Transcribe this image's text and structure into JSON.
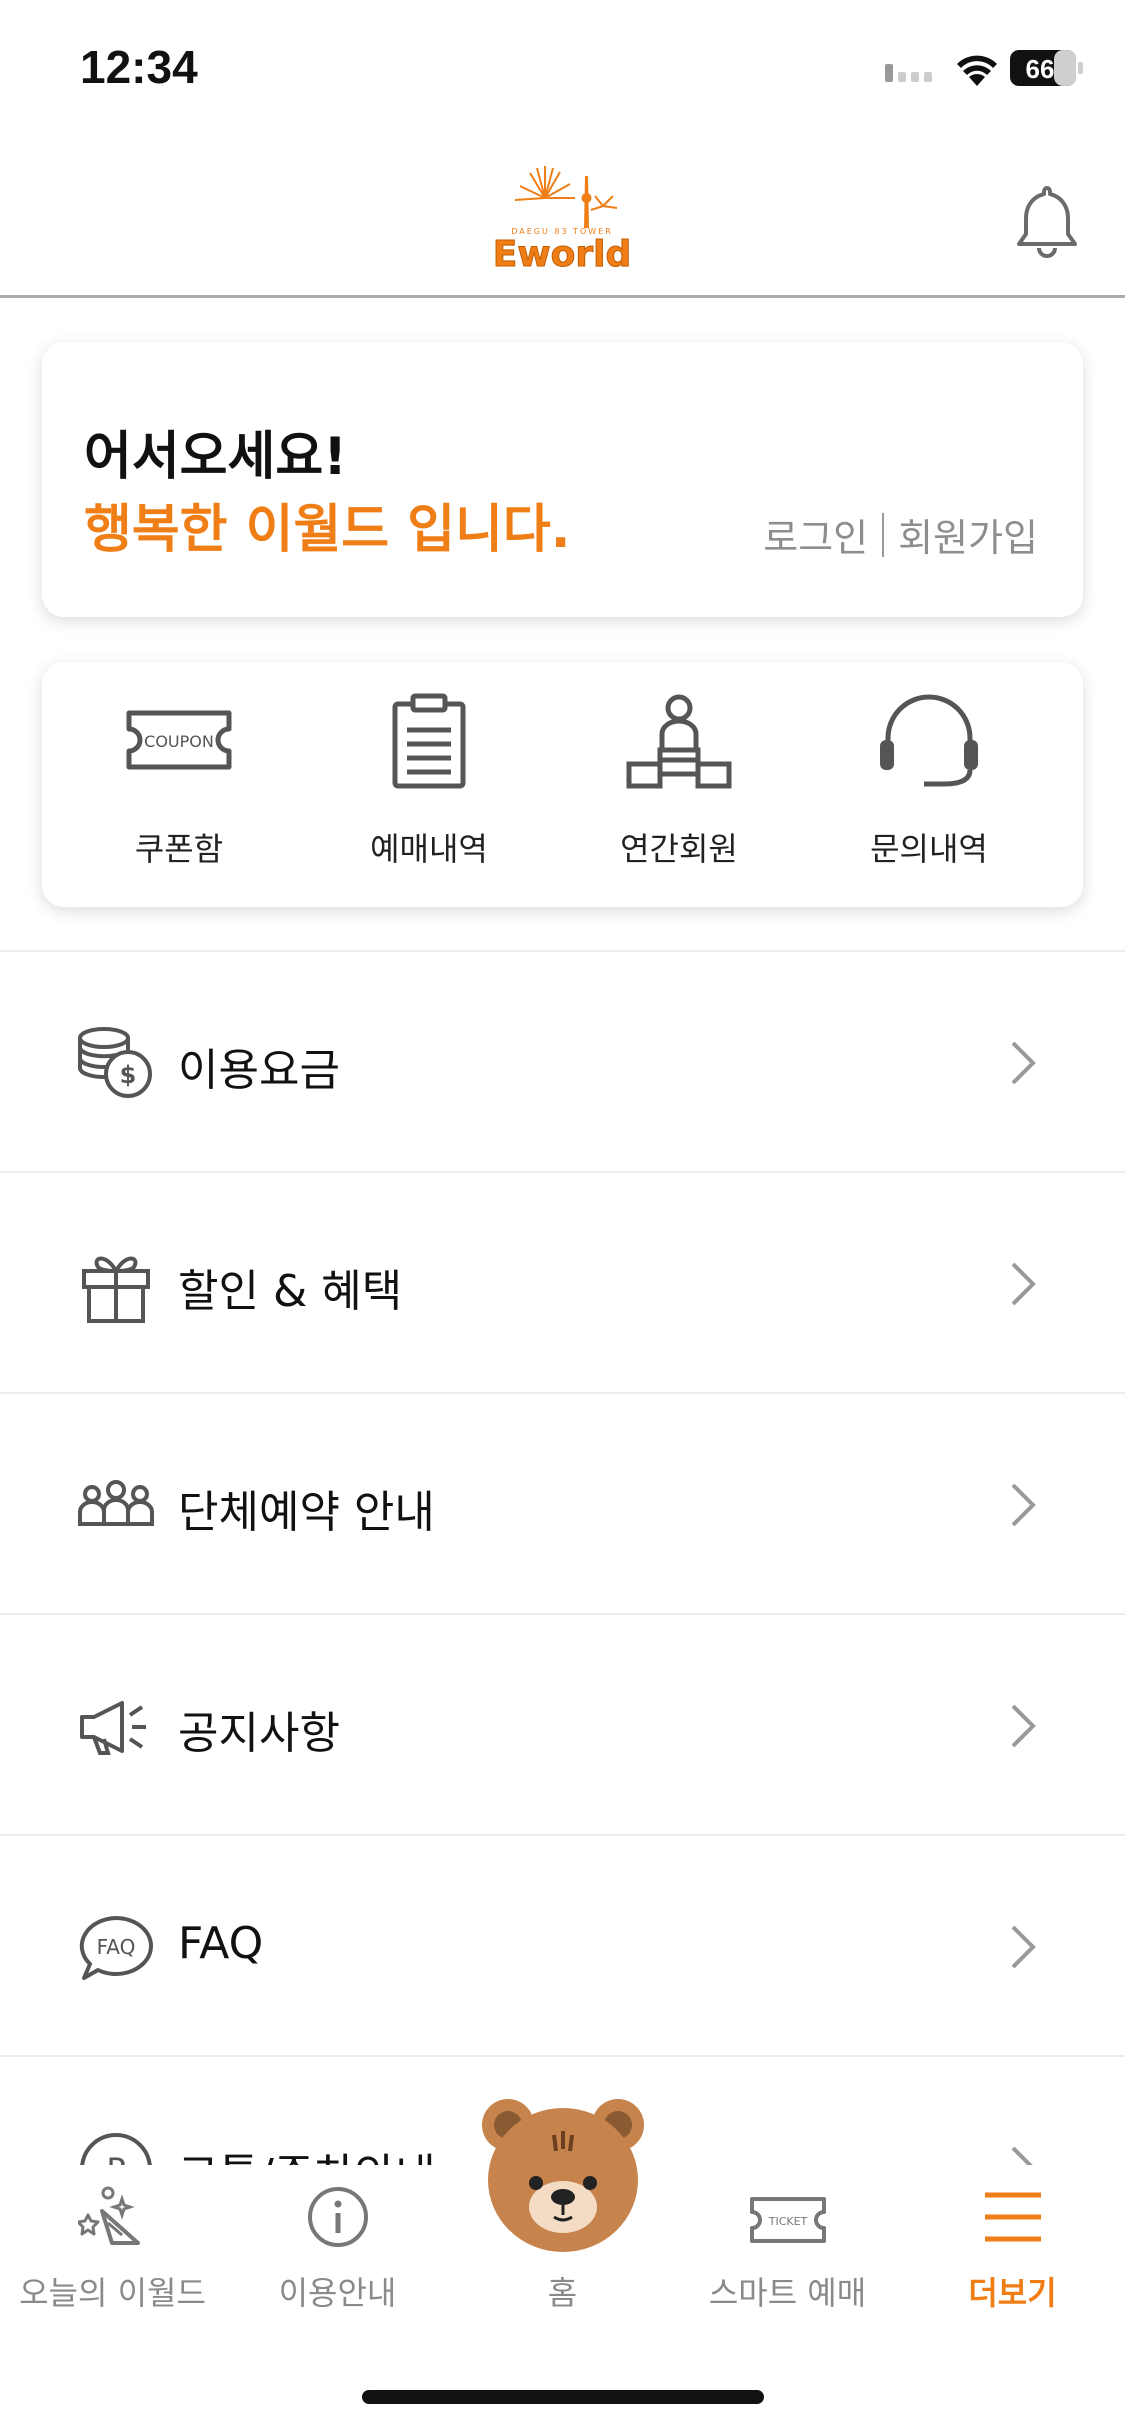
{
  "status_bar": {
    "time": "12:34",
    "battery": "66"
  },
  "header": {
    "logo_text": "Eworld",
    "logo_subtext": "DAEGU 83 TOWER"
  },
  "welcome": {
    "line1": "어서오세요!",
    "line2": "행복한 이월드 입니다.",
    "login": "로그인",
    "signup": "회원가입"
  },
  "quick_menu": [
    {
      "label": "쿠폰함",
      "icon": "coupon-icon",
      "icon_text": "COUPON"
    },
    {
      "label": "예매내역",
      "icon": "clipboard-icon"
    },
    {
      "label": "연간회원",
      "icon": "podium-icon"
    },
    {
      "label": "문의내역",
      "icon": "headset-icon"
    }
  ],
  "menu": [
    {
      "label": "이용요금",
      "icon": "coins-icon"
    },
    {
      "label": "할인 & 혜택",
      "icon": "gift-icon"
    },
    {
      "label": "단체예약 안내",
      "icon": "group-icon"
    },
    {
      "label": "공지사항",
      "icon": "megaphone-icon"
    },
    {
      "label": "FAQ",
      "icon": "faq-icon",
      "icon_text": "FAQ"
    },
    {
      "label": "교통/주차안내",
      "icon": "parking-icon",
      "icon_text": "P"
    }
  ],
  "tabs": [
    {
      "label": "오늘의 이월드",
      "icon": "party-icon"
    },
    {
      "label": "이용안내",
      "icon": "info-icon"
    },
    {
      "label": "홈",
      "icon": "bear-icon"
    },
    {
      "label": "스마트 예매",
      "icon": "ticket-icon",
      "icon_text": "TICKET"
    },
    {
      "label": "더보기",
      "icon": "menu-icon",
      "active": true
    }
  ],
  "colors": {
    "accent": "#f07e16",
    "text": "#111111",
    "muted": "#8a8a8a",
    "bear": "#c6834c"
  }
}
